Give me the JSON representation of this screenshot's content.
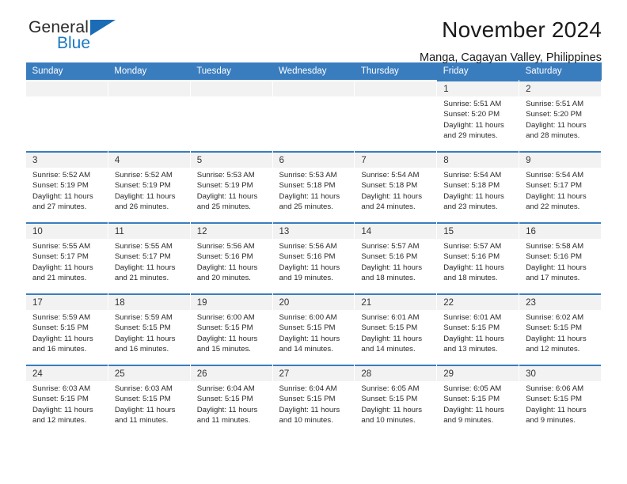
{
  "brand": {
    "name_top": "General",
    "name_bottom": "Blue",
    "accent_color": "#1b79c3",
    "header_color": "#3a7dbf"
  },
  "header": {
    "title": "November 2024",
    "location": "Manga, Cagayan Valley, Philippines"
  },
  "weekdays": [
    "Sunday",
    "Monday",
    "Tuesday",
    "Wednesday",
    "Thursday",
    "Friday",
    "Saturday"
  ],
  "weeks": [
    [
      {
        "day": "",
        "sunrise": "",
        "sunset": "",
        "daylight": ""
      },
      {
        "day": "",
        "sunrise": "",
        "sunset": "",
        "daylight": ""
      },
      {
        "day": "",
        "sunrise": "",
        "sunset": "",
        "daylight": ""
      },
      {
        "day": "",
        "sunrise": "",
        "sunset": "",
        "daylight": ""
      },
      {
        "day": "",
        "sunrise": "",
        "sunset": "",
        "daylight": ""
      },
      {
        "day": "1",
        "sunrise": "Sunrise: 5:51 AM",
        "sunset": "Sunset: 5:20 PM",
        "daylight": "Daylight: 11 hours and 29 minutes."
      },
      {
        "day": "2",
        "sunrise": "Sunrise: 5:51 AM",
        "sunset": "Sunset: 5:20 PM",
        "daylight": "Daylight: 11 hours and 28 minutes."
      }
    ],
    [
      {
        "day": "3",
        "sunrise": "Sunrise: 5:52 AM",
        "sunset": "Sunset: 5:19 PM",
        "daylight": "Daylight: 11 hours and 27 minutes."
      },
      {
        "day": "4",
        "sunrise": "Sunrise: 5:52 AM",
        "sunset": "Sunset: 5:19 PM",
        "daylight": "Daylight: 11 hours and 26 minutes."
      },
      {
        "day": "5",
        "sunrise": "Sunrise: 5:53 AM",
        "sunset": "Sunset: 5:19 PM",
        "daylight": "Daylight: 11 hours and 25 minutes."
      },
      {
        "day": "6",
        "sunrise": "Sunrise: 5:53 AM",
        "sunset": "Sunset: 5:18 PM",
        "daylight": "Daylight: 11 hours and 25 minutes."
      },
      {
        "day": "7",
        "sunrise": "Sunrise: 5:54 AM",
        "sunset": "Sunset: 5:18 PM",
        "daylight": "Daylight: 11 hours and 24 minutes."
      },
      {
        "day": "8",
        "sunrise": "Sunrise: 5:54 AM",
        "sunset": "Sunset: 5:18 PM",
        "daylight": "Daylight: 11 hours and 23 minutes."
      },
      {
        "day": "9",
        "sunrise": "Sunrise: 5:54 AM",
        "sunset": "Sunset: 5:17 PM",
        "daylight": "Daylight: 11 hours and 22 minutes."
      }
    ],
    [
      {
        "day": "10",
        "sunrise": "Sunrise: 5:55 AM",
        "sunset": "Sunset: 5:17 PM",
        "daylight": "Daylight: 11 hours and 21 minutes."
      },
      {
        "day": "11",
        "sunrise": "Sunrise: 5:55 AM",
        "sunset": "Sunset: 5:17 PM",
        "daylight": "Daylight: 11 hours and 21 minutes."
      },
      {
        "day": "12",
        "sunrise": "Sunrise: 5:56 AM",
        "sunset": "Sunset: 5:16 PM",
        "daylight": "Daylight: 11 hours and 20 minutes."
      },
      {
        "day": "13",
        "sunrise": "Sunrise: 5:56 AM",
        "sunset": "Sunset: 5:16 PM",
        "daylight": "Daylight: 11 hours and 19 minutes."
      },
      {
        "day": "14",
        "sunrise": "Sunrise: 5:57 AM",
        "sunset": "Sunset: 5:16 PM",
        "daylight": "Daylight: 11 hours and 18 minutes."
      },
      {
        "day": "15",
        "sunrise": "Sunrise: 5:57 AM",
        "sunset": "Sunset: 5:16 PM",
        "daylight": "Daylight: 11 hours and 18 minutes."
      },
      {
        "day": "16",
        "sunrise": "Sunrise: 5:58 AM",
        "sunset": "Sunset: 5:16 PM",
        "daylight": "Daylight: 11 hours and 17 minutes."
      }
    ],
    [
      {
        "day": "17",
        "sunrise": "Sunrise: 5:59 AM",
        "sunset": "Sunset: 5:15 PM",
        "daylight": "Daylight: 11 hours and 16 minutes."
      },
      {
        "day": "18",
        "sunrise": "Sunrise: 5:59 AM",
        "sunset": "Sunset: 5:15 PM",
        "daylight": "Daylight: 11 hours and 16 minutes."
      },
      {
        "day": "19",
        "sunrise": "Sunrise: 6:00 AM",
        "sunset": "Sunset: 5:15 PM",
        "daylight": "Daylight: 11 hours and 15 minutes."
      },
      {
        "day": "20",
        "sunrise": "Sunrise: 6:00 AM",
        "sunset": "Sunset: 5:15 PM",
        "daylight": "Daylight: 11 hours and 14 minutes."
      },
      {
        "day": "21",
        "sunrise": "Sunrise: 6:01 AM",
        "sunset": "Sunset: 5:15 PM",
        "daylight": "Daylight: 11 hours and 14 minutes."
      },
      {
        "day": "22",
        "sunrise": "Sunrise: 6:01 AM",
        "sunset": "Sunset: 5:15 PM",
        "daylight": "Daylight: 11 hours and 13 minutes."
      },
      {
        "day": "23",
        "sunrise": "Sunrise: 6:02 AM",
        "sunset": "Sunset: 5:15 PM",
        "daylight": "Daylight: 11 hours and 12 minutes."
      }
    ],
    [
      {
        "day": "24",
        "sunrise": "Sunrise: 6:03 AM",
        "sunset": "Sunset: 5:15 PM",
        "daylight": "Daylight: 11 hours and 12 minutes."
      },
      {
        "day": "25",
        "sunrise": "Sunrise: 6:03 AM",
        "sunset": "Sunset: 5:15 PM",
        "daylight": "Daylight: 11 hours and 11 minutes."
      },
      {
        "day": "26",
        "sunrise": "Sunrise: 6:04 AM",
        "sunset": "Sunset: 5:15 PM",
        "daylight": "Daylight: 11 hours and 11 minutes."
      },
      {
        "day": "27",
        "sunrise": "Sunrise: 6:04 AM",
        "sunset": "Sunset: 5:15 PM",
        "daylight": "Daylight: 11 hours and 10 minutes."
      },
      {
        "day": "28",
        "sunrise": "Sunrise: 6:05 AM",
        "sunset": "Sunset: 5:15 PM",
        "daylight": "Daylight: 11 hours and 10 minutes."
      },
      {
        "day": "29",
        "sunrise": "Sunrise: 6:05 AM",
        "sunset": "Sunset: 5:15 PM",
        "daylight": "Daylight: 11 hours and 9 minutes."
      },
      {
        "day": "30",
        "sunrise": "Sunrise: 6:06 AM",
        "sunset": "Sunset: 5:15 PM",
        "daylight": "Daylight: 11 hours and 9 minutes."
      }
    ]
  ]
}
